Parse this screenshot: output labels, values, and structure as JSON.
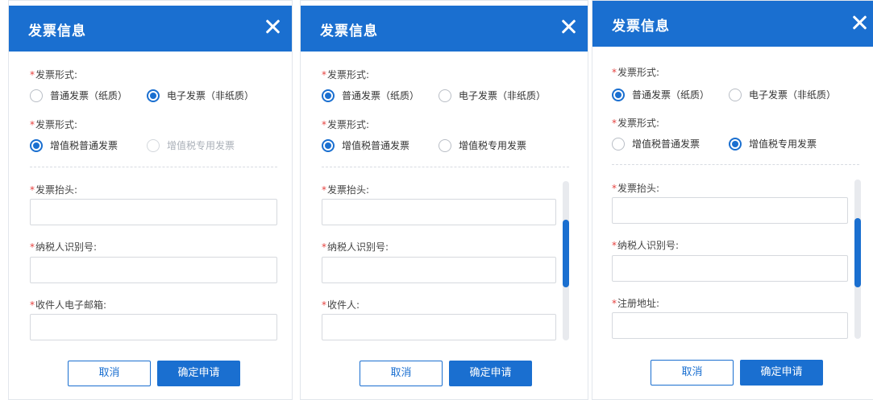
{
  "panels": [
    {
      "title": "发票信息",
      "form_label_1": "发票形式:",
      "form_options_1": [
        "普通发票（纸质）",
        "电子发票（非纸质）"
      ],
      "form_label_2": "发票形式:",
      "form_options_2": [
        "增值税普通发票",
        "增值税专用发票"
      ],
      "field_labels": [
        "发票抬头:",
        "纳税人识别号:",
        "收件人电子邮箱:"
      ],
      "cancel": "取消",
      "confirm": "确定申请"
    },
    {
      "title": "发票信息",
      "form_label_1": "发票形式:",
      "form_options_1": [
        "普通发票（纸质）",
        "电子发票（非纸质）"
      ],
      "form_label_2": "发票形式:",
      "form_options_2": [
        "增值税普通发票",
        "增值税专用发票"
      ],
      "field_labels": [
        "发票抬头:",
        "纳税人识别号:",
        "收件人:"
      ],
      "cancel": "取消",
      "confirm": "确定申请"
    },
    {
      "title": "发票信息",
      "form_label_1": "发票形式:",
      "form_options_1": [
        "普通发票（纸质）",
        "电子发票（非纸质）"
      ],
      "form_label_2": "发票形式:",
      "form_options_2": [
        "增值税普通发票",
        "增值税专用发票"
      ],
      "field_labels": [
        "发票抬头:",
        "纳税人识别号:",
        "注册地址:"
      ],
      "cancel": "取消",
      "confirm": "确定申请"
    }
  ],
  "required_mark": "*",
  "selected": {
    "panel1": {
      "row1": 1,
      "row2": 0
    },
    "panel2": {
      "row1": 0,
      "row2": 0
    },
    "panel3": {
      "row1": 0,
      "row2": 1
    }
  },
  "colors": {
    "accent": "#1a6fd0",
    "required": "#e64340",
    "disabled_text": "#aab0b8"
  },
  "icons": {
    "close": "close-icon",
    "radio": "radio-icon"
  }
}
